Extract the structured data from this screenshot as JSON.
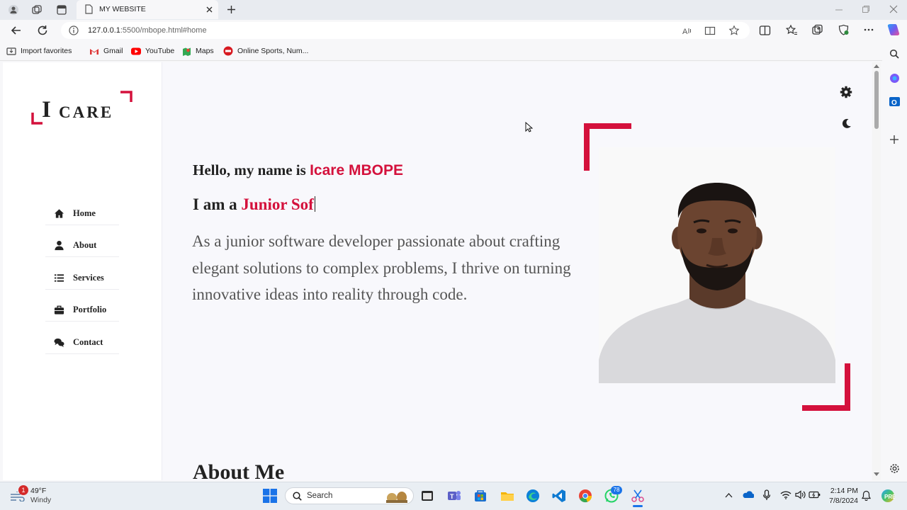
{
  "browser": {
    "tab_title": "MY WEBSITE",
    "url_host": "127.0.0.1",
    "url_rest": ":5500/mbope.html#home",
    "favorites": [
      {
        "label": "Import favorites",
        "icon": "import-icon"
      },
      {
        "label": "Gmail",
        "icon": "gmail-icon"
      },
      {
        "label": "YouTube",
        "icon": "youtube-icon"
      },
      {
        "label": "Maps",
        "icon": "maps-icon"
      },
      {
        "label": "Online Sports, Num...",
        "icon": "sports-icon"
      }
    ]
  },
  "site": {
    "logo_initial": "I",
    "logo_rest": "CARE",
    "nav": [
      {
        "label": "Home",
        "icon": "home-icon"
      },
      {
        "label": "About",
        "icon": "user-icon"
      },
      {
        "label": "Services",
        "icon": "list-icon"
      },
      {
        "label": "Portfolio",
        "icon": "briefcase-icon"
      },
      {
        "label": "Contact",
        "icon": "comments-icon"
      }
    ],
    "hero": {
      "hello_prefix": "Hello, my name is ",
      "name": "Icare MBOPE",
      "iam_prefix": "I am a ",
      "role_typed": "Junior Sof",
      "intro": "As a junior software developer passionate about crafting elegant solutions to complex problems, I thrive on turning innovative ideas into reality through code."
    },
    "about_title": "About Me",
    "accent_color": "#d4113c"
  },
  "taskbar": {
    "weather_temp": "49°F",
    "weather_desc": "Windy",
    "weather_badge": "1",
    "search_label": "Search",
    "whatsapp_badge": "78",
    "time": "2:14 PM",
    "date": "7/8/2024"
  }
}
